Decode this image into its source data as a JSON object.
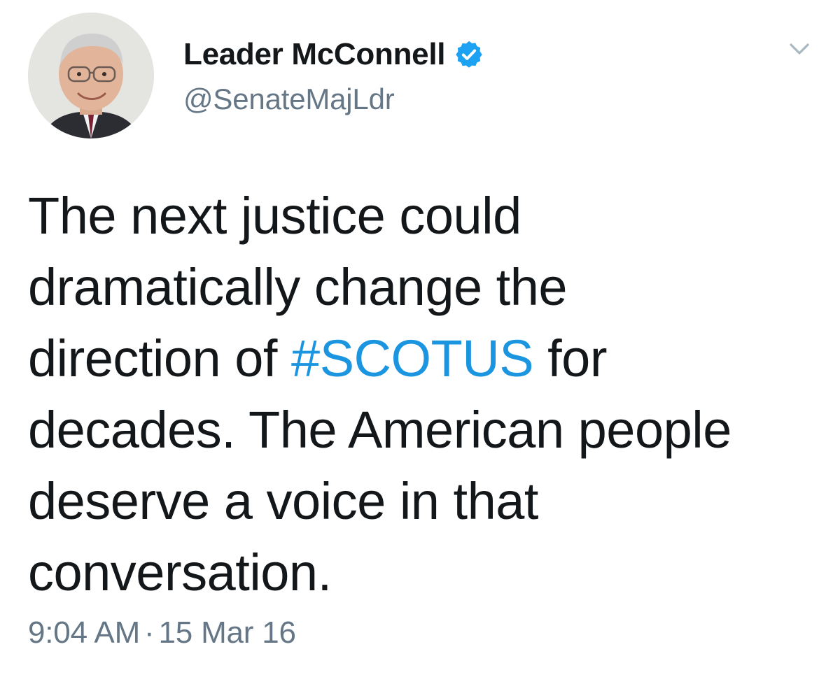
{
  "author": {
    "display_name": "Leader McConnell",
    "handle": "@SenateMajLdr",
    "verified": true,
    "avatar_icon": "profile-photo"
  },
  "tweet": {
    "lines": [
      {
        "before": "The next justice could",
        "hashtag": "",
        "after": ""
      },
      {
        "before": "dramatically change the",
        "hashtag": "",
        "after": ""
      },
      {
        "before": "direction of ",
        "hashtag": "#SCOTUS",
        "after": " for"
      },
      {
        "before": "decades. The American people",
        "hashtag": "",
        "after": ""
      },
      {
        "before": "deserve a voice in that",
        "hashtag": "",
        "after": ""
      },
      {
        "before": "conversation.",
        "hashtag": "",
        "after": ""
      }
    ],
    "time": "9:04 AM",
    "separator": "·",
    "date": "15 Mar 16"
  },
  "icons": {
    "verified_badge": "verified-badge-icon",
    "menu": "chevron-down-icon"
  },
  "colors": {
    "text": "#14171a",
    "secondary": "#657786",
    "link": "#1b95e0",
    "verified": "#1da1f2"
  }
}
